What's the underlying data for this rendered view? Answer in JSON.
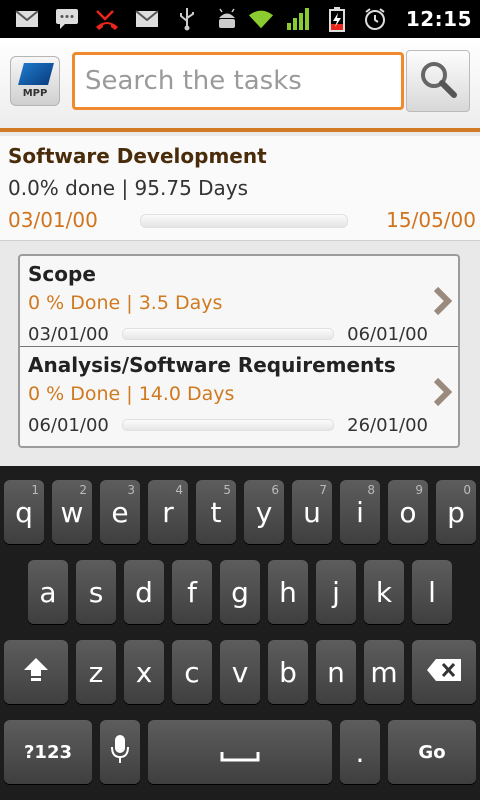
{
  "status_bar": {
    "time": "12:15",
    "left_icons": [
      "gmail-icon",
      "sms-icon",
      "missed-call-icon",
      "gmail-icon",
      "usb-icon",
      "android-debug-icon"
    ],
    "right_icons": [
      "wifi-icon",
      "signal-icon",
      "battery-charging-icon",
      "alarm-icon"
    ]
  },
  "header": {
    "logo_text": "MPP",
    "search_placeholder": "Search the tasks",
    "search_value": "",
    "accent_color": "#f08a2c"
  },
  "project": {
    "title": "Software Development",
    "summary": "0.0% done | 95.75 Days",
    "start": "03/01/00",
    "end": "15/05/00",
    "progress": 0.0
  },
  "tasks": [
    {
      "name": "Scope",
      "meta": "0 % Done | 3.5 Days",
      "start": "03/01/00",
      "end": "06/01/00",
      "progress": 0
    },
    {
      "name": "Analysis/Software Requirements",
      "meta": "0 % Done | 14.0 Days",
      "start": "06/01/00",
      "end": "26/01/00",
      "progress": 0
    }
  ],
  "keyboard": {
    "row1": [
      {
        "k": "q",
        "h": "1"
      },
      {
        "k": "w",
        "h": "2"
      },
      {
        "k": "e",
        "h": "3"
      },
      {
        "k": "r",
        "h": "4"
      },
      {
        "k": "t",
        "h": "5"
      },
      {
        "k": "y",
        "h": "6"
      },
      {
        "k": "u",
        "h": "7"
      },
      {
        "k": "i",
        "h": "8"
      },
      {
        "k": "o",
        "h": "9"
      },
      {
        "k": "p",
        "h": "0"
      }
    ],
    "row2": [
      "a",
      "s",
      "d",
      "f",
      "g",
      "h",
      "j",
      "k",
      "l"
    ],
    "row3": [
      "z",
      "x",
      "c",
      "v",
      "b",
      "n",
      "m"
    ],
    "symbols": "?123",
    "period": ".",
    "go": "Go"
  }
}
